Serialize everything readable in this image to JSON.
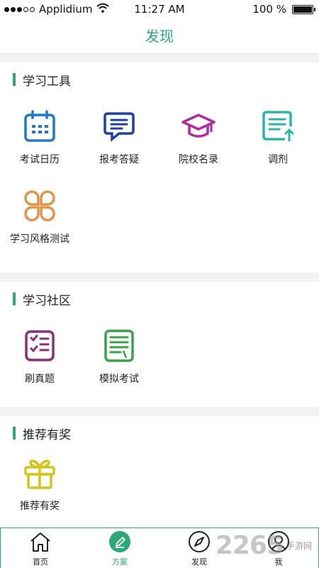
{
  "status": {
    "carrier": "Applidium",
    "time": "11:27 AM",
    "battery": "100 %"
  },
  "nav": {
    "title": "发现"
  },
  "sections": [
    {
      "title": "学习工具",
      "items": [
        {
          "label": "考试日历",
          "icon": "calendar-icon",
          "color": "#1f78c8"
        },
        {
          "label": "报考答疑",
          "icon": "chat-icon",
          "color": "#1c3fa8"
        },
        {
          "label": "院校名录",
          "icon": "graduation-cap-icon",
          "color": "#b02aa0"
        },
        {
          "label": "调剂",
          "icon": "document-arrow-icon",
          "color": "#2bb5a8"
        },
        {
          "label": "学习风格测试",
          "icon": "clover-icon",
          "color": "#e0954a"
        }
      ]
    },
    {
      "title": "学习社区",
      "items": [
        {
          "label": "刷真题",
          "icon": "checklist-icon",
          "color": "#8a2f7f"
        },
        {
          "label": "模拟考试",
          "icon": "exam-paper-icon",
          "color": "#3aa04a"
        }
      ]
    },
    {
      "title": "推荐有奖",
      "items": [
        {
          "label": "推荐有奖",
          "icon": "gift-icon",
          "color": "#d4c41a"
        }
      ]
    }
  ],
  "tabs": [
    {
      "label": "首页",
      "icon": "home-icon"
    },
    {
      "label": "方案",
      "icon": "edit-icon",
      "active": true
    },
    {
      "label": "发现",
      "icon": "compass-icon"
    },
    {
      "label": "我",
      "icon": "user-icon"
    }
  ],
  "watermark": {
    "number": "2265",
    "text": "手游网"
  },
  "colors": {
    "accent": "#2aa876"
  }
}
